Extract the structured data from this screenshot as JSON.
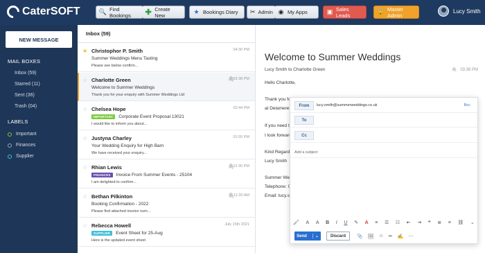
{
  "brand": {
    "name": "CaterSOFT"
  },
  "topnav": {
    "find_bookings": "Find Bookings",
    "create_new": "Create New",
    "bookings_diary": "Bookings Diary",
    "admin": "Admin",
    "my_apps": "My Apps",
    "sales_leads": "Sales Leads",
    "master_admin": "Master Admin",
    "user_name": "Lucy Smith"
  },
  "sidebar": {
    "new_message": "NEW MESSAGE",
    "mailboxes_title": "MAIL BOXES",
    "mailboxes": [
      "Inbox (59)",
      "Starred (11)",
      "Sent (36)",
      "Trash (04)"
    ],
    "labels_title": "LABELS",
    "labels": [
      {
        "name": "Important",
        "color": "#7ec93e"
      },
      {
        "name": "Finances",
        "color": "#8fa7c4"
      },
      {
        "name": "Supplier",
        "color": "#3fc0d8"
      }
    ]
  },
  "inbox": {
    "header": "Inbox (59)",
    "messages": [
      {
        "from": "Christophor P. Smith",
        "time": "04:30 PM",
        "subject": "Summer Weddings Menu Tasting",
        "preview": "Please see below confirm...",
        "starred": true,
        "attachment": false
      },
      {
        "from": "Charlotte Green",
        "time": "03:38 PM",
        "subject": "Welcome to Summer Weddings",
        "preview": "Thank you for your enquiry with Summer Weddings Ltd",
        "starred": false,
        "attachment": true
      },
      {
        "from": "Chelsea Hope",
        "time": "02:44 PM",
        "subject": "Corporate Event Proposal 13021",
        "preview": "I would like to inform you about...",
        "tag": "IMPORTANT",
        "tag_color": "#7ec93e"
      },
      {
        "from": "Justyna Charley",
        "time": "01:55 PM",
        "subject": "Your Wedding Enquiry for High Barn",
        "preview": "We have received your enquiry..."
      },
      {
        "from": "Rhian Lewis",
        "time": "12:30 PM",
        "subject": "Invoice From Summer Events - 25104",
        "preview": "I am delighted to confirm...",
        "tag": "FINANCES",
        "tag_color": "#6a4fb0",
        "attachment": true
      },
      {
        "from": "Bethan Pilkinton",
        "time": "11:30 AM",
        "subject": "Booking Confirmation - 2022",
        "preview": "Please find attached invoice num...",
        "attachment": true
      },
      {
        "from": "Rebecca Howell",
        "time": "July 15th 2021",
        "subject": "Event Sheet for 25-Aug",
        "preview": "Here is the updated event sheet",
        "tag": "SUPPLIER",
        "tag_color": "#3fc0d8"
      }
    ]
  },
  "reading": {
    "title": "Welcome to Summer Weddings",
    "meta": "Lucy Smith to Charlotte Green",
    "time": "03:38 PM",
    "lines": [
      "Hello Charlotte,",
      "Thank you fo",
      "at Delamere",
      "If you need to",
      "I look forward",
      "Kind Regard",
      "Lucy Smith",
      "Summer Wed",
      "Telephone: 0",
      "Email: lucy.s"
    ]
  },
  "compose": {
    "from_label": "From",
    "from_value": "lucy.smith@summerweddings.co.uk",
    "bcc": "Bcc",
    "to_label": "To",
    "cc_label": "Cc",
    "subject_placeholder": "Add a subject",
    "send": "Send",
    "discard": "Discard"
  }
}
